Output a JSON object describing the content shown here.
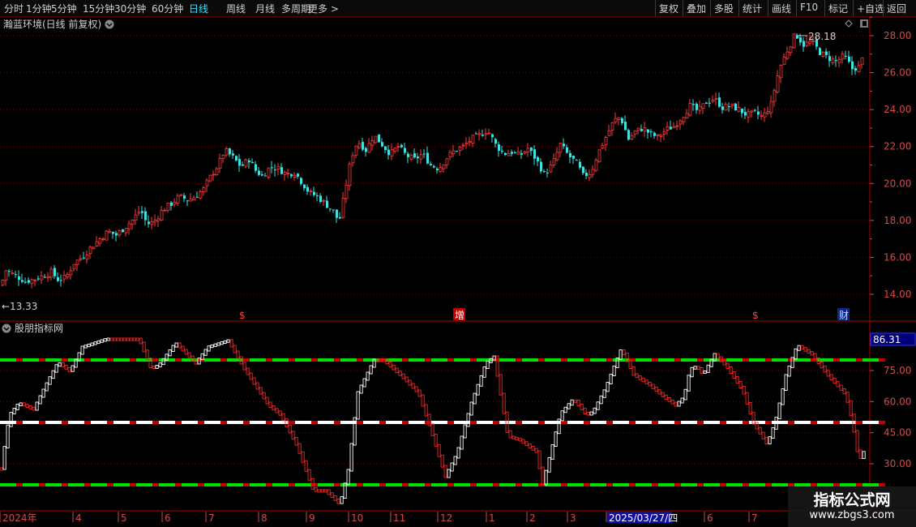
{
  "toolbar": {
    "left_items": [
      "分时",
      "1分钟",
      "5分钟",
      "15分钟",
      "30分钟",
      "60分钟",
      "日线",
      "周线",
      "月线",
      "多周期",
      "更多 >"
    ],
    "active_index": 6,
    "right_items": [
      "复权",
      "叠加",
      "多股",
      "统计",
      "画线",
      "F10",
      "标记",
      "+自选",
      "返回"
    ]
  },
  "main_panel": {
    "title": "瀚蓝环境(日线 前复权)",
    "high_label": "28.18",
    "low_label": "←13.33",
    "price_axis": [
      "28.00",
      "26.00",
      "24.00",
      "22.00",
      "20.00",
      "18.00",
      "16.00",
      "14.00"
    ],
    "event_markers": [
      "$",
      "增",
      "$",
      "财"
    ]
  },
  "indicator_panel": {
    "title": "股朋指标网",
    "current_value": "86.31",
    "axis": [
      "75.00",
      "60.00",
      "45.00",
      "30.00"
    ]
  },
  "time_axis": {
    "labels": [
      "2024年",
      "4",
      "5",
      "6",
      "7",
      "8",
      "9",
      "10",
      "11",
      "12",
      "1",
      "2",
      "3",
      "2025/03/27/四",
      "6",
      "7"
    ]
  },
  "watermark": {
    "title": "指标公式网",
    "url": "www.zbgs3.com"
  },
  "colors": {
    "up": "#ff3c3c",
    "down": "#40e0e0",
    "grid": "#7a0000",
    "axis_text": "#d24a4a",
    "green_line": "#00e000",
    "white_line": "#ffffff",
    "active_tab": "#40e0ff",
    "background": "#000000"
  },
  "chart_data": {
    "type": "candlestick",
    "price_range": [
      13.0,
      29.0
    ],
    "price_high": 28.18,
    "price_low": 13.33,
    "close_path": [
      [
        0,
        14.5
      ],
      [
        6,
        15.3
      ],
      [
        14,
        15.1
      ],
      [
        22,
        14.9
      ],
      [
        30,
        14.7
      ],
      [
        40,
        14.8
      ],
      [
        52,
        15.0
      ],
      [
        62,
        15.2
      ],
      [
        70,
        14.8
      ],
      [
        80,
        14.9
      ],
      [
        90,
        15.7
      ],
      [
        100,
        16.0
      ],
      [
        110,
        16.5
      ],
      [
        122,
        17.0
      ],
      [
        132,
        17.4
      ],
      [
        142,
        17.2
      ],
      [
        152,
        17.6
      ],
      [
        162,
        18.0
      ],
      [
        172,
        18.6
      ],
      [
        180,
        17.8
      ],
      [
        188,
        17.9
      ],
      [
        200,
        18.6
      ],
      [
        210,
        18.9
      ],
      [
        220,
        19.3
      ],
      [
        230,
        19.1
      ],
      [
        240,
        19.3
      ],
      [
        250,
        19.7
      ],
      [
        260,
        20.5
      ],
      [
        268,
        21.0
      ],
      [
        276,
        21.8
      ],
      [
        286,
        21.4
      ],
      [
        296,
        20.9
      ],
      [
        306,
        21.3
      ],
      [
        314,
        20.7
      ],
      [
        322,
        20.4
      ],
      [
        332,
        20.9
      ],
      [
        342,
        20.8
      ],
      [
        352,
        20.5
      ],
      [
        362,
        20.6
      ],
      [
        372,
        20.0
      ],
      [
        380,
        19.5
      ],
      [
        390,
        19.3
      ],
      [
        400,
        18.9
      ],
      [
        410,
        18.5
      ],
      [
        417,
        17.9
      ],
      [
        424,
        19.5
      ],
      [
        432,
        21.4
      ],
      [
        440,
        22.3
      ],
      [
        450,
        21.8
      ],
      [
        460,
        22.6
      ],
      [
        470,
        22.1
      ],
      [
        480,
        21.6
      ],
      [
        490,
        22.0
      ],
      [
        500,
        21.5
      ],
      [
        510,
        21.3
      ],
      [
        520,
        21.6
      ],
      [
        530,
        21.0
      ],
      [
        540,
        20.8
      ],
      [
        550,
        21.4
      ],
      [
        560,
        21.8
      ],
      [
        570,
        22.0
      ],
      [
        580,
        22.4
      ],
      [
        590,
        22.6
      ],
      [
        600,
        22.9
      ],
      [
        610,
        22.1
      ],
      [
        620,
        21.6
      ],
      [
        630,
        21.7
      ],
      [
        640,
        21.5
      ],
      [
        650,
        21.9
      ],
      [
        660,
        21.3
      ],
      [
        670,
        20.5
      ],
      [
        680,
        21.0
      ],
      [
        690,
        22.1
      ],
      [
        700,
        21.5
      ],
      [
        710,
        21.1
      ],
      [
        718,
        20.4
      ],
      [
        728,
        20.6
      ],
      [
        736,
        21.6
      ],
      [
        746,
        22.5
      ],
      [
        756,
        23.4
      ],
      [
        764,
        23.6
      ],
      [
        774,
        22.4
      ],
      [
        782,
        22.8
      ],
      [
        792,
        23.0
      ],
      [
        800,
        22.7
      ],
      [
        810,
        22.5
      ],
      [
        820,
        22.9
      ],
      [
        830,
        23.1
      ],
      [
        840,
        23.6
      ],
      [
        850,
        24.2
      ],
      [
        860,
        23.9
      ],
      [
        870,
        24.4
      ],
      [
        880,
        24.6
      ],
      [
        890,
        24.1
      ],
      [
        900,
        24.2
      ],
      [
        910,
        24.0
      ],
      [
        920,
        23.7
      ],
      [
        930,
        23.8
      ],
      [
        940,
        23.6
      ],
      [
        950,
        24.3
      ],
      [
        960,
        26.2
      ],
      [
        970,
        27.2
      ],
      [
        980,
        28.1
      ],
      [
        990,
        27.5
      ],
      [
        1000,
        27.7
      ],
      [
        1010,
        27.1
      ],
      [
        1020,
        26.8
      ],
      [
        1030,
        26.6
      ],
      [
        1040,
        26.9
      ],
      [
        1050,
        26.2
      ],
      [
        1058,
        26.3
      ],
      [
        1065,
        27.0
      ]
    ]
  }
}
